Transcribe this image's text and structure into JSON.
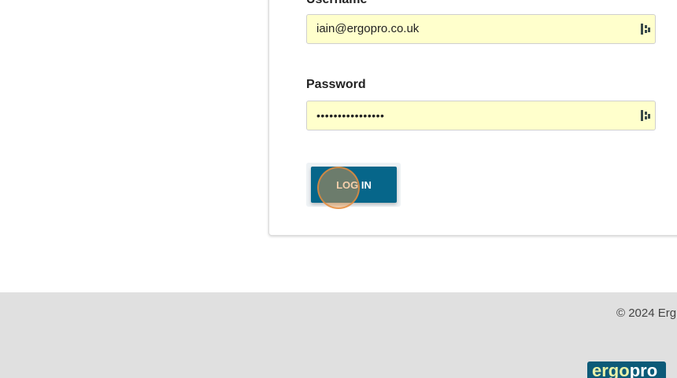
{
  "login_form": {
    "username_label": "Username",
    "username_value": "iain@ergopro.co.uk",
    "password_label": "Password",
    "password_value": "••••••••••••••••",
    "login_button": "LOG IN"
  },
  "footer": {
    "copyright": "© 2024 Erg",
    "logo_part1": "ergo",
    "logo_part2": "pro"
  },
  "icons": {
    "password_manager": "password-manager-icon"
  },
  "colors": {
    "field_bg": "#ffffcc",
    "button_bg": "#06668a",
    "footer_bg": "#e0e0e0",
    "logo_bg": "#0c5a78"
  }
}
